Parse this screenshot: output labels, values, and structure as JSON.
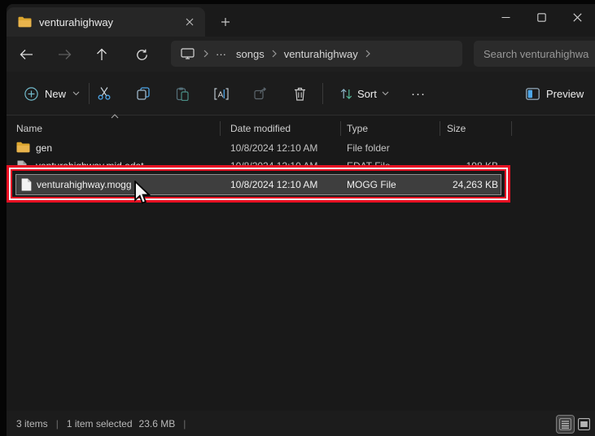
{
  "colors": {
    "accent_blue": "#4da6e8",
    "accent_teal": "#53b9ab",
    "annotation_red": "#e81123",
    "folder_yellow": "#e9b44c",
    "selection_bg": "#3e3e3e"
  },
  "titlebar": {
    "tab_title": "venturahighway"
  },
  "navbar": {
    "breadcrumb": {
      "ellipsis": "···",
      "segments": [
        "songs",
        "venturahighway"
      ]
    },
    "search_placeholder": "Search venturahighwa"
  },
  "toolbar": {
    "new_label": "New",
    "sort_label": "Sort",
    "more_label": "···",
    "preview_label": "Preview"
  },
  "list": {
    "columns": [
      "Name",
      "Date modified",
      "Type",
      "Size"
    ],
    "files": [
      {
        "name": "gen",
        "date_modified": "10/8/2024 12:10 AM",
        "type": "File folder",
        "size": ""
      },
      {
        "name": "venturahighway.mid.edat",
        "date_modified": "10/8/2024 12:10 AM",
        "type": "EDAT File",
        "size": "198 KB"
      },
      {
        "name": "venturahighway.mogg",
        "date_modified": "10/8/2024 12:10 AM",
        "type": "MOGG File",
        "size": "24,263 KB"
      }
    ]
  },
  "statusbar": {
    "item_count": "3 items",
    "separator": "|",
    "selection_count": "1 item selected",
    "selection_size": "23.6 MB"
  }
}
